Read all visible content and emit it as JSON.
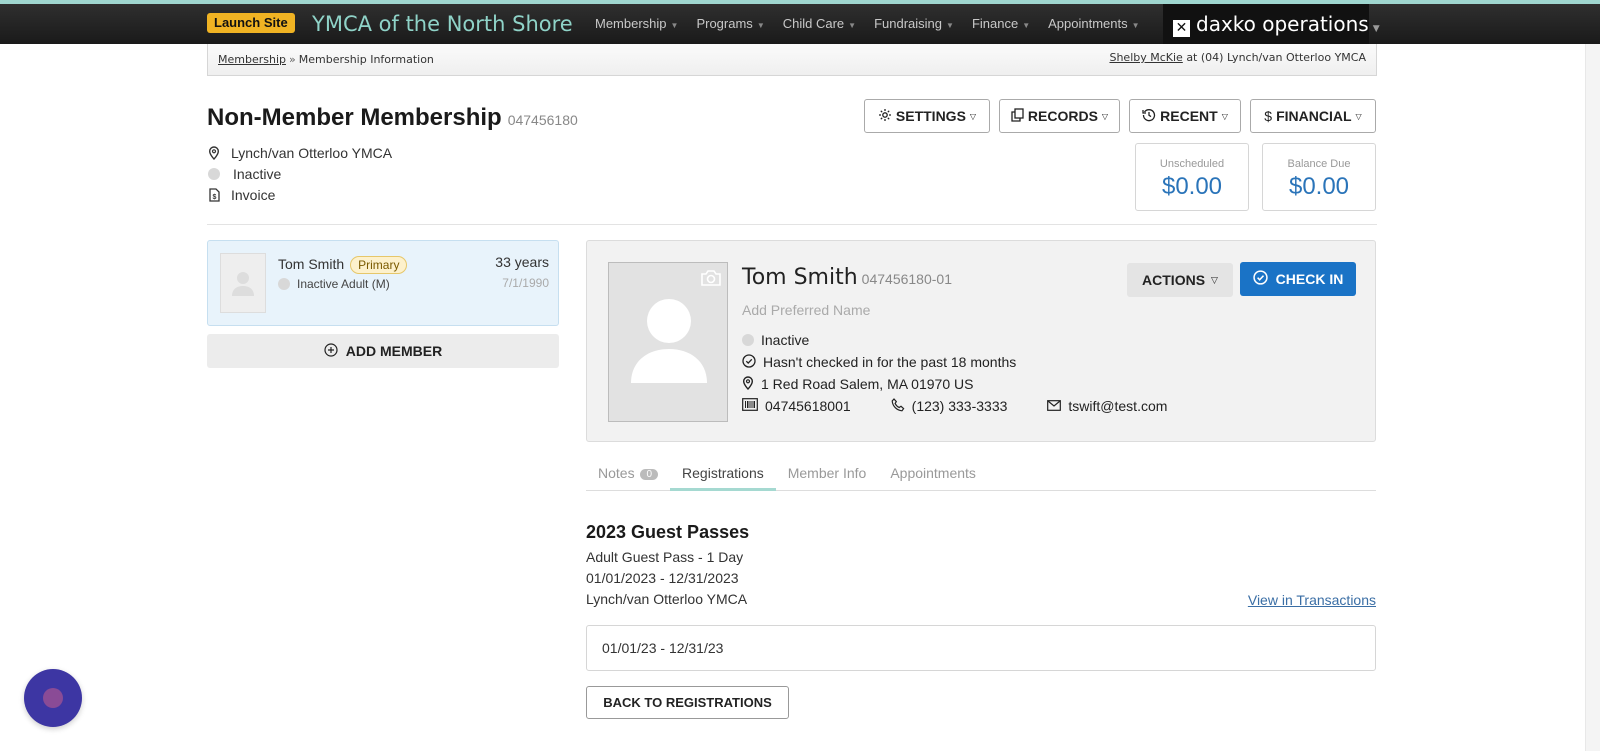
{
  "navbar": {
    "launch_label": "Launch Site",
    "org_name": "YMCA of the North Shore",
    "items": [
      {
        "label": "Membership"
      },
      {
        "label": "Programs"
      },
      {
        "label": "Child Care"
      },
      {
        "label": "Fundraising"
      },
      {
        "label": "Finance"
      },
      {
        "label": "Appointments"
      }
    ],
    "brand": "daxko operations"
  },
  "breadcrumb": {
    "root": "Membership",
    "current": "Membership Information",
    "user_name": "Shelby McKie",
    "user_location": "at (04) Lynch/van Otterloo YMCA"
  },
  "membership": {
    "title": "Non-Member Membership",
    "number": "047456180",
    "location": "Lynch/van Otterloo YMCA",
    "status": "Inactive",
    "billing": "Invoice"
  },
  "toolbar": {
    "settings_label": "SETTINGS",
    "records_label": "RECORDS",
    "recent_label": "RECENT",
    "financial_label": "FINANCIAL"
  },
  "balances": {
    "unscheduled_label": "Unscheduled",
    "unscheduled_value": "$0.00",
    "balance_due_label": "Balance Due",
    "balance_due_value": "$0.00"
  },
  "member_card": {
    "name": "Tom Smith",
    "badge": "Primary",
    "status": "Inactive Adult (M)",
    "age": "33 years",
    "dob": "7/1/1990"
  },
  "add_member_label": "ADD MEMBER",
  "profile": {
    "name": "Tom Smith",
    "member_number": "047456180-01",
    "preferred_name_placeholder": "Add Preferred Name",
    "status": "Inactive",
    "checkin_note": "Hasn't checked in for the past 18 months",
    "address": "1 Red Road Salem, MA 01970 US",
    "barcode": "04745618001",
    "phone": "(123) 333-3333",
    "email": "tswift@test.com",
    "actions_label": "ACTIONS",
    "checkin_label": "CHECK IN"
  },
  "tabs": [
    {
      "label": "Notes",
      "count": "0"
    },
    {
      "label": "Registrations"
    },
    {
      "label": "Member Info"
    },
    {
      "label": "Appointments"
    }
  ],
  "registration": {
    "title": "2023 Guest Passes",
    "item": "Adult Guest Pass - 1 Day",
    "dates": "01/01/2023 - 12/31/2023",
    "location": "Lynch/van Otterloo YMCA",
    "view_link": "View in Transactions",
    "date_range": "01/01/23 - 12/31/23",
    "back_label": "BACK TO REGISTRATIONS"
  },
  "colors": {
    "accent": "#1a73c6",
    "launch": "#f0b323",
    "org": "#8fd3c8",
    "money": "#2a74b9"
  }
}
